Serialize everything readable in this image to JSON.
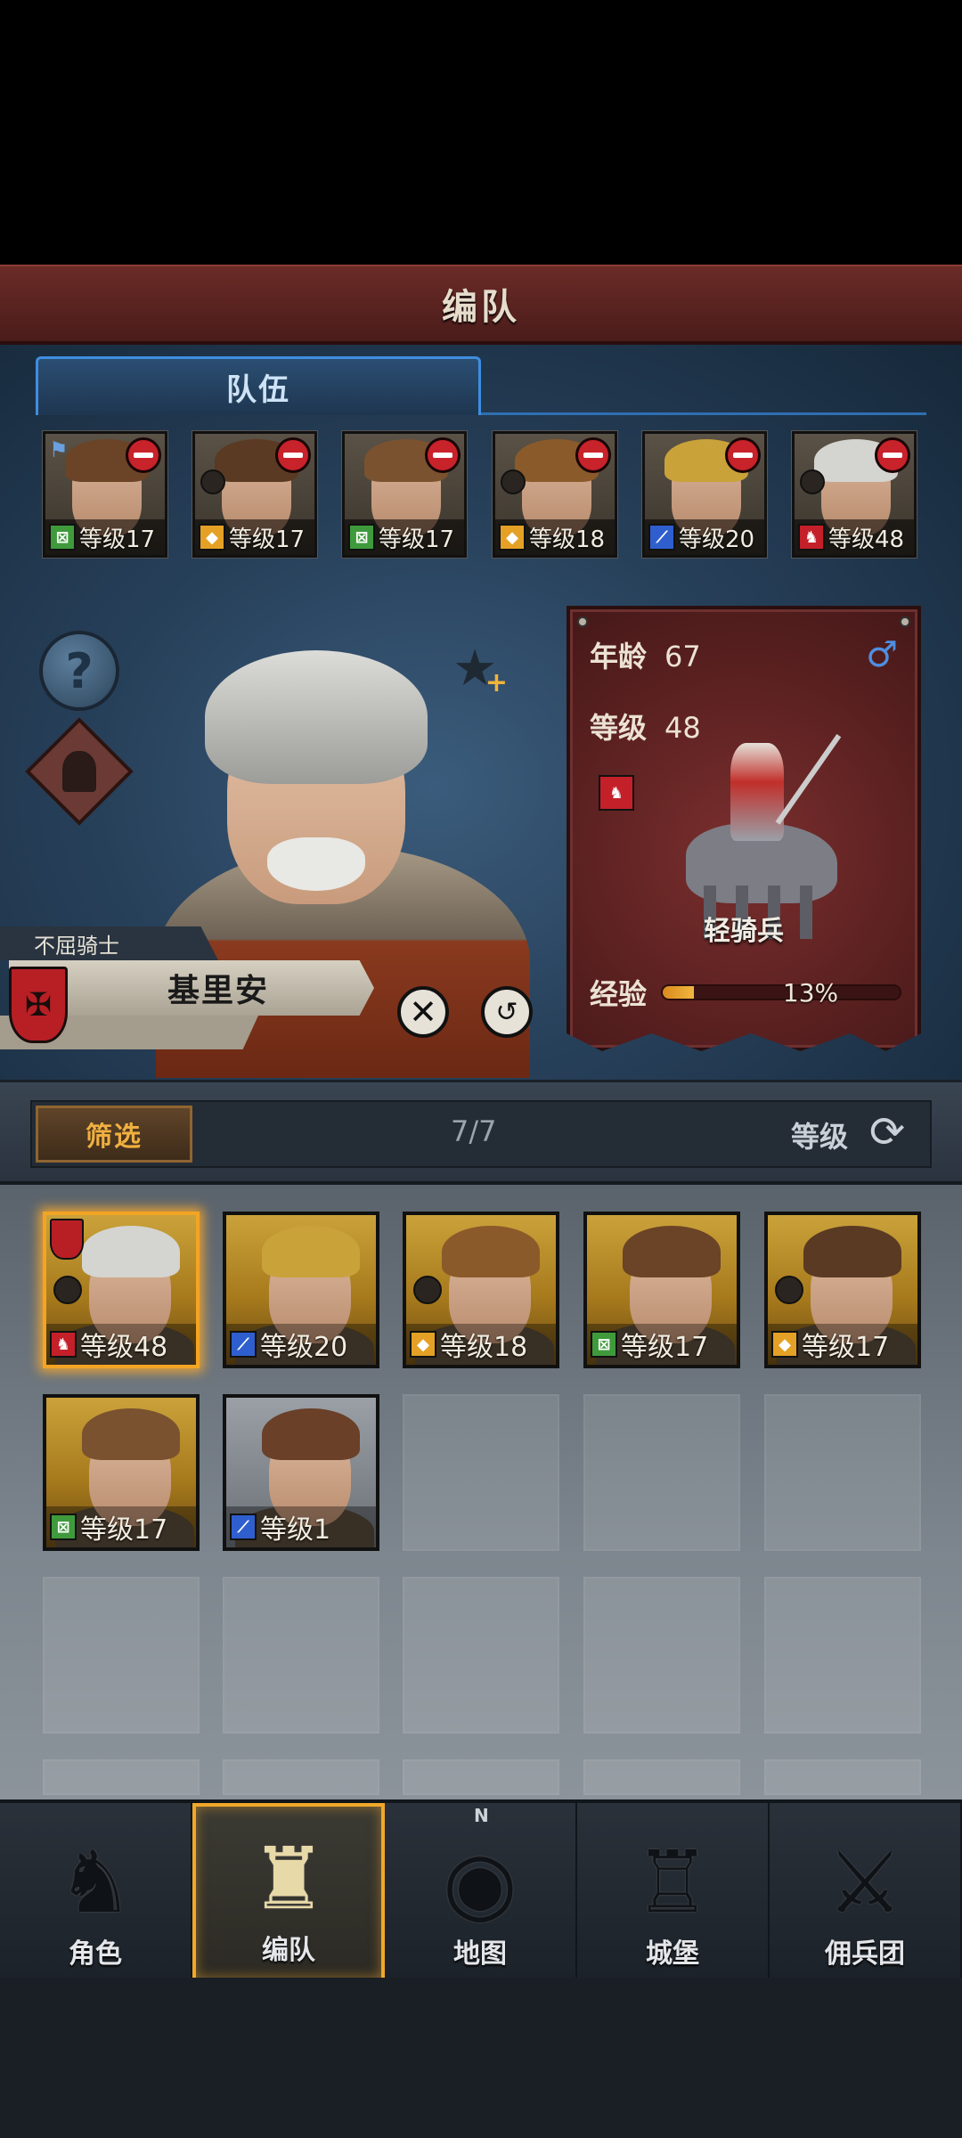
{
  "header": {
    "title": "编队"
  },
  "team": {
    "tab_label": "队伍",
    "slots": [
      {
        "level_label": "等级17",
        "class": "archer",
        "hair": "#6b4326",
        "flag": true,
        "knight": false
      },
      {
        "level_label": "等级17",
        "class": "shield",
        "hair": "#5a3a22",
        "flag": false,
        "knight": true
      },
      {
        "level_label": "等级17",
        "class": "archer",
        "hair": "#7a5230",
        "flag": false,
        "knight": false
      },
      {
        "level_label": "等级18",
        "class": "shield",
        "hair": "#8a5a2a",
        "flag": false,
        "knight": true
      },
      {
        "level_label": "等级20",
        "class": "sword",
        "hair": "#c9a23a",
        "flag": false,
        "knight": false
      },
      {
        "level_label": "等级48",
        "class": "cavalry",
        "hair": "#d4d4d0",
        "flag": false,
        "knight": true
      }
    ]
  },
  "hero": {
    "title": "不屈骑士",
    "name": "基里安",
    "stats": {
      "age_label": "年龄",
      "age": "67",
      "level_label": "等级",
      "level": "48",
      "gender_icon": "♂",
      "unit_type": "轻骑兵",
      "xp_label": "经验",
      "xp_text": "13%",
      "xp_fraction": 0.13
    }
  },
  "filter": {
    "filter_label": "筛选",
    "count": "7/7",
    "sort_label": "等级"
  },
  "roster": [
    {
      "level_label": "等级48",
      "class": "cavalry",
      "hair": "#d4d4d0",
      "selected": true,
      "crest": true,
      "knight": true,
      "bg": "gold"
    },
    {
      "level_label": "等级20",
      "class": "sword",
      "hair": "#c9a23a",
      "selected": false,
      "crest": false,
      "knight": false,
      "bg": "gold"
    },
    {
      "level_label": "等级18",
      "class": "shield",
      "hair": "#8a5a2a",
      "selected": false,
      "crest": false,
      "knight": true,
      "bg": "gold"
    },
    {
      "level_label": "等级17",
      "class": "archer",
      "hair": "#6b4326",
      "selected": false,
      "crest": false,
      "knight": false,
      "bg": "gold"
    },
    {
      "level_label": "等级17",
      "class": "shield",
      "hair": "#5a3a22",
      "selected": false,
      "crest": false,
      "knight": true,
      "bg": "gold"
    },
    {
      "level_label": "等级17",
      "class": "archer",
      "hair": "#7a5230",
      "selected": false,
      "crest": false,
      "knight": false,
      "bg": "gold"
    },
    {
      "level_label": "等级1",
      "class": "sword",
      "hair": "#6a4028",
      "selected": false,
      "crest": false,
      "knight": false,
      "bg": "grey"
    }
  ],
  "nav": [
    {
      "label": "角色",
      "icon": "knight-helmet-icon",
      "glyph": "♞",
      "active": false
    },
    {
      "label": "编队",
      "icon": "formation-helmet-icon",
      "glyph": "♜",
      "active": true
    },
    {
      "label": "地图",
      "icon": "compass-map-icon",
      "glyph": "◉",
      "active": false
    },
    {
      "label": "城堡",
      "icon": "castle-icon",
      "glyph": "♖",
      "active": false
    },
    {
      "label": "佣兵团",
      "icon": "mercenary-banner-icon",
      "glyph": "⚔",
      "active": false
    }
  ],
  "colors": {
    "archer": "#3f9a3c",
    "shield": "#e5a126",
    "sword": "#2f5fcf",
    "cavalry": "#c4202a",
    "accent": "#f0a82a"
  }
}
